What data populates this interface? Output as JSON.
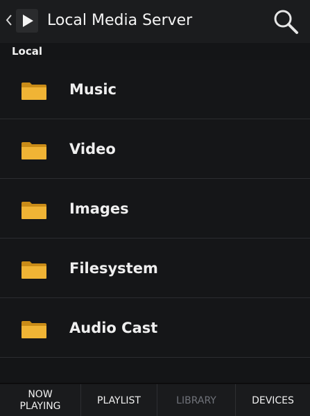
{
  "action_bar": {
    "title": "Local Media Server",
    "back_icon": "chevron-left-icon",
    "app_icon": "play-icon",
    "search_icon": "search-icon"
  },
  "section": {
    "label": "Local"
  },
  "list": {
    "items": [
      {
        "label": "Music",
        "icon": "folder-icon"
      },
      {
        "label": "Video",
        "icon": "folder-icon"
      },
      {
        "label": "Images",
        "icon": "folder-icon"
      },
      {
        "label": "Filesystem",
        "icon": "folder-icon"
      },
      {
        "label": "Audio Cast",
        "icon": "folder-icon"
      }
    ]
  },
  "tabs": {
    "now_playing_line1": "NOW",
    "now_playing_line2": "PLAYING",
    "playlist": "PLAYLIST",
    "library": "LIBRARY",
    "devices": "DEVICES",
    "active": "library"
  },
  "colors": {
    "folder": "#f0b435",
    "folder_dark": "#c98c18",
    "background": "#141517",
    "inactive_tab": "#70737a"
  }
}
